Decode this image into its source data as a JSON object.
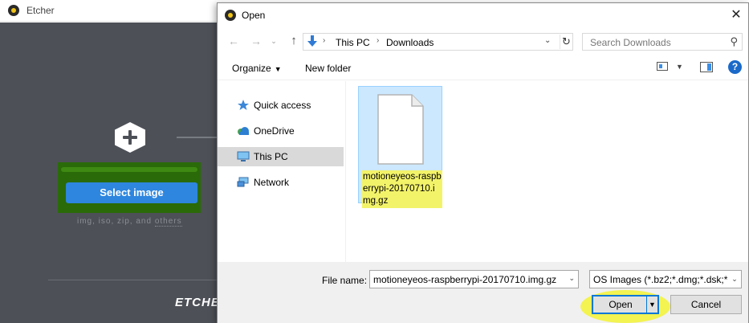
{
  "etcher": {
    "window_title": "Etcher",
    "select_image_label": "Select image",
    "extensions_text": "img, iso, zip, and",
    "extensions_link": "others",
    "logo_text": "ETCHER"
  },
  "dialog": {
    "title": "Open",
    "breadcrumb": [
      "This PC",
      "Downloads"
    ],
    "search_placeholder": "Search Downloads",
    "toolbar": {
      "organize_label": "Organize",
      "new_folder_label": "New folder",
      "help_label": "?"
    },
    "nav_pane": [
      {
        "label": "Quick access",
        "icon": "star-icon"
      },
      {
        "label": "OneDrive",
        "icon": "cloud-icon"
      },
      {
        "label": "This PC",
        "icon": "monitor-icon",
        "selected": true
      },
      {
        "label": "Network",
        "icon": "network-icon"
      }
    ],
    "files": [
      {
        "name": "motioneyeos-raspberrypi-20170710.img.gz",
        "display_name": "motioneyeos-raspberrypi-20170710.img.gz",
        "selected": true
      }
    ],
    "file_name_label": "File name:",
    "file_name_value": "motioneyeos-raspberrypi-20170710.img.gz",
    "file_type_value": "OS Images (*.bz2;*.dmg;*.dsk;*.",
    "open_button": "Open",
    "cancel_button": "Cancel"
  },
  "colors": {
    "etcher_bg": "#4d5057",
    "select_button": "#2e86de",
    "selection_bg": "#cce8ff",
    "highlight_yellow": "#f3f352",
    "accent_blue": "#0078d7"
  }
}
